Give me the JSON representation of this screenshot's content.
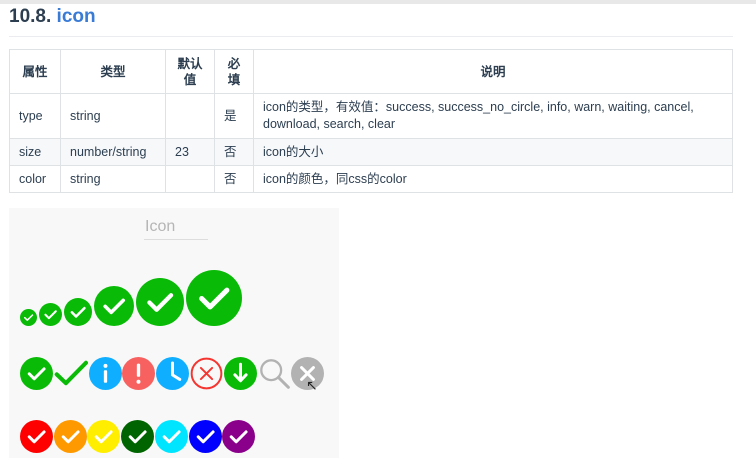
{
  "section": {
    "number": "10.8.",
    "title": "icon"
  },
  "table": {
    "headers": [
      "属性",
      "类型",
      "默认值",
      "必填",
      "说明"
    ],
    "rows": [
      [
        "type",
        "string",
        "",
        "是",
        "icon的类型，有效值：success, success_no_circle, info, warn, waiting, cancel, download, search, clear"
      ],
      [
        "size",
        "number/string",
        "23",
        "否",
        "icon的大小"
      ],
      [
        "color",
        "string",
        "",
        "否",
        "icon的颜色，同css的color"
      ]
    ]
  },
  "demo": {
    "title": "Icon",
    "sizes_row": {
      "icon": "success-icon",
      "color": "#09BB07",
      "sizes": [
        17,
        23,
        28,
        40,
        48,
        56
      ]
    },
    "types_row": [
      {
        "type": "success",
        "color": "#09BB07"
      },
      {
        "type": "success_no_circle",
        "color": "#09BB07"
      },
      {
        "type": "info",
        "color": "#10AEFF"
      },
      {
        "type": "warn",
        "color": "#F76260"
      },
      {
        "type": "waiting",
        "color": "#10AEFF"
      },
      {
        "type": "cancel",
        "color": "#F43530"
      },
      {
        "type": "download",
        "color": "#09BB07"
      },
      {
        "type": "search",
        "color": "#B2B2B2"
      },
      {
        "type": "clear",
        "color": "#B2B2B2"
      }
    ],
    "colors_row": [
      "#FF0000",
      "#FF9900",
      "#FFEE00",
      "#006400",
      "#00E5FF",
      "#0000FF",
      "#8B008B"
    ]
  }
}
